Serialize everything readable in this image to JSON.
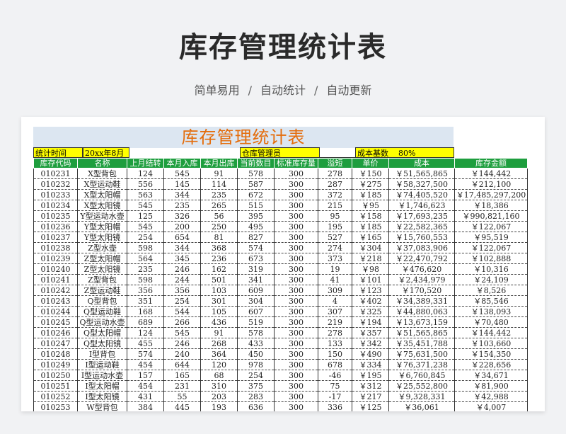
{
  "header": {
    "title": "库存管理统计表",
    "features": [
      "简单易用",
      "自动统计",
      "自动更新"
    ],
    "separator": "/"
  },
  "sheet": {
    "title": "库存管理统计表",
    "period_label": "统计时间",
    "period_value": "20xx年8月",
    "manager_label": "仓库管理员",
    "cost_base_label": "成本基数",
    "cost_base_value": "80%"
  },
  "table": {
    "columns": [
      "库存代码",
      "名称",
      "上月结转",
      "本月入库",
      "本月出库",
      "当前数目",
      "标准库存量",
      "溢短",
      "单价",
      "成本",
      "库存金额"
    ],
    "rows": [
      [
        "010231",
        "X型背包",
        "124",
        "545",
        "91",
        "578",
        "300",
        "278",
        "￥150",
        "￥51,565,865",
        "￥144,442"
      ],
      [
        "010232",
        "X型运动鞋",
        "556",
        "145",
        "114",
        "587",
        "300",
        "287",
        "￥275",
        "￥58,327,500",
        "￥212,100"
      ],
      [
        "010233",
        "X型太阳帽",
        "563",
        "344",
        "235",
        "672",
        "300",
        "372",
        "￥185",
        "￥74,405,520",
        "￥17,485,297,200"
      ],
      [
        "010234",
        "X型太阳镜",
        "545",
        "235",
        "265",
        "515",
        "300",
        "215",
        "￥95",
        "￥1,746,623",
        "￥18,386"
      ],
      [
        "010235",
        "Y型运动水壶",
        "125",
        "326",
        "56",
        "395",
        "300",
        "95",
        "￥158",
        "￥17,693,235",
        "￥990,821,160"
      ],
      [
        "010236",
        "Y型太阳帽",
        "545",
        "200",
        "250",
        "495",
        "300",
        "195",
        "￥185",
        "￥22,582,365",
        "￥122,067"
      ],
      [
        "010237",
        "Y型太阳镜",
        "254",
        "654",
        "81",
        "827",
        "300",
        "527",
        "￥165",
        "￥15,760,553",
        "￥95,519"
      ],
      [
        "010238",
        "Z型水壶",
        "598",
        "344",
        "368",
        "574",
        "300",
        "274",
        "￥304",
        "￥37,083,906",
        "￥122,067"
      ],
      [
        "010239",
        "Z型太阳帽",
        "564",
        "345",
        "236",
        "673",
        "300",
        "373",
        "￥218",
        "￥22,470,792",
        "￥102,888"
      ],
      [
        "010240",
        "Z型太阳镜",
        "235",
        "246",
        "162",
        "319",
        "300",
        "19",
        "￥98",
        "￥476,620",
        "￥10,316"
      ],
      [
        "010241",
        "Z型背包",
        "598",
        "244",
        "501",
        "341",
        "300",
        "41",
        "￥101",
        "￥2,434,979",
        "￥24,109"
      ],
      [
        "010242",
        "Z型运动鞋",
        "356",
        "356",
        "103",
        "609",
        "300",
        "309",
        "￥123",
        "￥170,520",
        "￥8,526"
      ],
      [
        "010243",
        "Q型背包",
        "351",
        "254",
        "301",
        "304",
        "300",
        "4",
        "￥402",
        "￥34,389,331",
        "￥85,546"
      ],
      [
        "010244",
        "Q型运动鞋",
        "168",
        "544",
        "105",
        "607",
        "300",
        "307",
        "￥325",
        "￥44,880,063",
        "￥138,093"
      ],
      [
        "010245",
        "Q型运动水壶",
        "689",
        "266",
        "436",
        "519",
        "300",
        "219",
        "￥194",
        "￥13,673,159",
        "￥70,480"
      ],
      [
        "010246",
        "Q型太阳帽",
        "124",
        "545",
        "91",
        "578",
        "300",
        "278",
        "￥357",
        "￥51,565,865",
        "￥144,442"
      ],
      [
        "010247",
        "Q型太阳镜",
        "455",
        "246",
        "268",
        "433",
        "300",
        "133",
        "￥342",
        "￥35,451,788",
        "￥103,660"
      ],
      [
        "010248",
        "I型背包",
        "574",
        "240",
        "364",
        "450",
        "300",
        "150",
        "￥490",
        "￥75,631,500",
        "￥154,350"
      ],
      [
        "010249",
        "I型运动鞋",
        "454",
        "644",
        "120",
        "978",
        "300",
        "678",
        "￥334",
        "￥76,371,238",
        "￥228,656"
      ],
      [
        "010250",
        "I型运动水壶",
        "157",
        "165",
        "68",
        "254",
        "300",
        "-46",
        "￥195",
        "￥6,760,845",
        "￥34,671"
      ],
      [
        "010251",
        "I型太阳帽",
        "454",
        "231",
        "310",
        "375",
        "300",
        "75",
        "￥312",
        "￥25,552,800",
        "￥81,900"
      ],
      [
        "010252",
        "I型太阳镜",
        "431",
        "55",
        "203",
        "283",
        "300",
        "-17",
        "￥217",
        "￥9,328,331",
        "￥42,988"
      ],
      [
        "010253",
        "W型背包",
        "384",
        "445",
        "193",
        "636",
        "300",
        "336",
        "￥125",
        "￥36,061",
        "￥4,007"
      ]
    ]
  }
}
